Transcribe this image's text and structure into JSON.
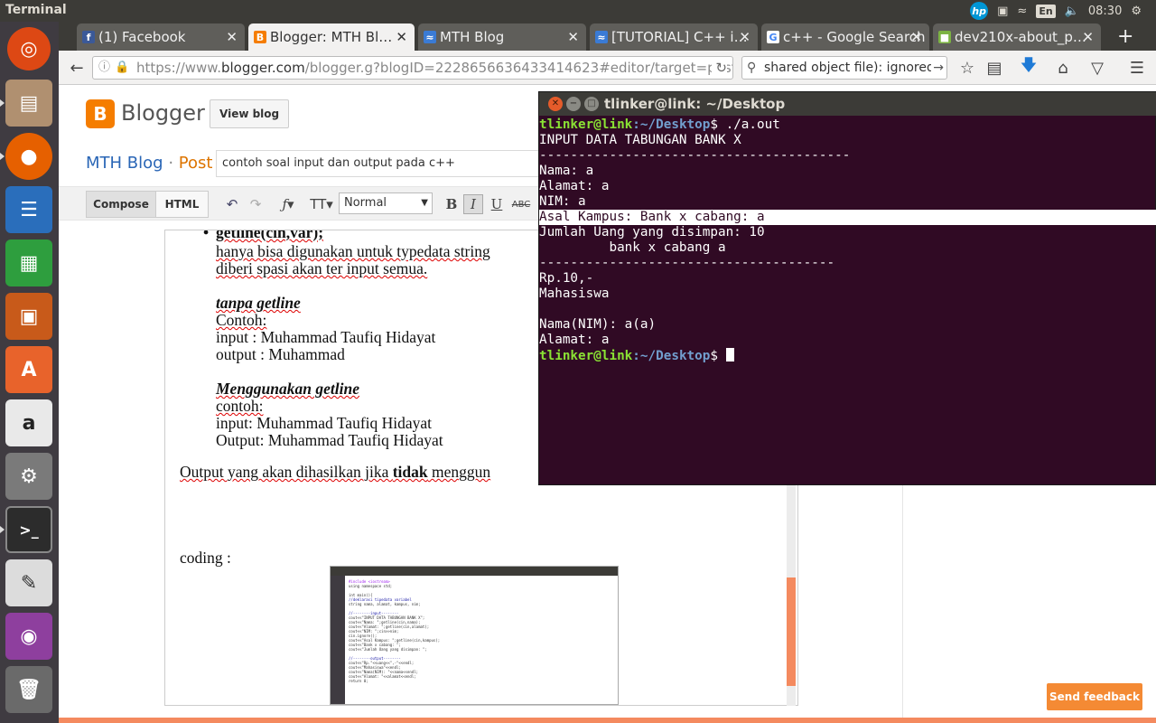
{
  "system": {
    "app_title": "Terminal",
    "keyboard": "En",
    "time": "08:30",
    "hp": "hp"
  },
  "launcher": {
    "items": [
      "Ubuntu Dash",
      "Files",
      "Firefox",
      "LibreOffice Writer",
      "LibreOffice Calc",
      "LibreOffice Impress",
      "Ubuntu Software",
      "Amazon",
      "System Settings",
      "Terminal",
      "Text Editor",
      "Screenshot",
      "Trash"
    ]
  },
  "browser": {
    "tabs": [
      {
        "label": "(1) Facebook"
      },
      {
        "label": "Blogger: MTH Bl…"
      },
      {
        "label": "MTH Blog"
      },
      {
        "label": "[TUTORIAL] C++ i…"
      },
      {
        "label": "c++ - Google Search"
      },
      {
        "label": "dev210x-about_p…"
      }
    ],
    "url_prefix": "https://www.",
    "url_domain": "blogger.com",
    "url_rest": "/blogger.g?blogID=2228656636433414623#editor/target=post;",
    "search_text": "shared object file): ignored."
  },
  "blogger": {
    "brand": "Blogger",
    "view_blog": "View blog",
    "blog_name": "MTH Blog",
    "separator": "·",
    "post_label": "Post",
    "post_title": "contoh soal input dan output pada c++",
    "mode_compose": "Compose",
    "mode_html": "HTML",
    "font_style": "Normal",
    "send_feedback": "Send feedback"
  },
  "editor": {
    "heading": "getline(cin,var);",
    "line1": "hanya bisa digunakan untuk typedata string",
    "line2": "diberi spasi akan ter input semua.",
    "tanpa": "tanpa getline",
    "contoh1": "Contoh:",
    "input1": "input : Muhammad Taufiq Hidayat",
    "output1": "output : Muhammad",
    "menggunakan": "Menggunakan getline",
    "contoh2": "contoh:",
    "input2": "input: Muhammad Taufiq Hidayat",
    "output2": "Output: Muhammad Taufiq Hidayat",
    "para_pre": "Output yang akan dihasilkan jika ",
    "para_bold": "tidak",
    "para_post": " menggun",
    "coding": "coding :"
  },
  "terminal": {
    "title": "tlinker@link: ~/Desktop",
    "prompt_user": "tlinker@link",
    "prompt_path": ":~/Desktop",
    "prompt_sign": "$ ",
    "command": "./a.out",
    "lines": [
      "INPUT DATA TABUNGAN BANK X",
      "----------------------------------------",
      "",
      "Nama: a",
      "Alamat: a",
      "NIM: a",
      "Asal Kampus: Bank x cabang: a",
      "Jumlah Uang yang disimpan: 10",
      "         bank x cabang a",
      "--------------------------------------",
      "Rp.10,-",
      "Mahasiswa",
      "",
      "Nama(NIM): a(a)",
      "Alamat: a"
    ]
  }
}
